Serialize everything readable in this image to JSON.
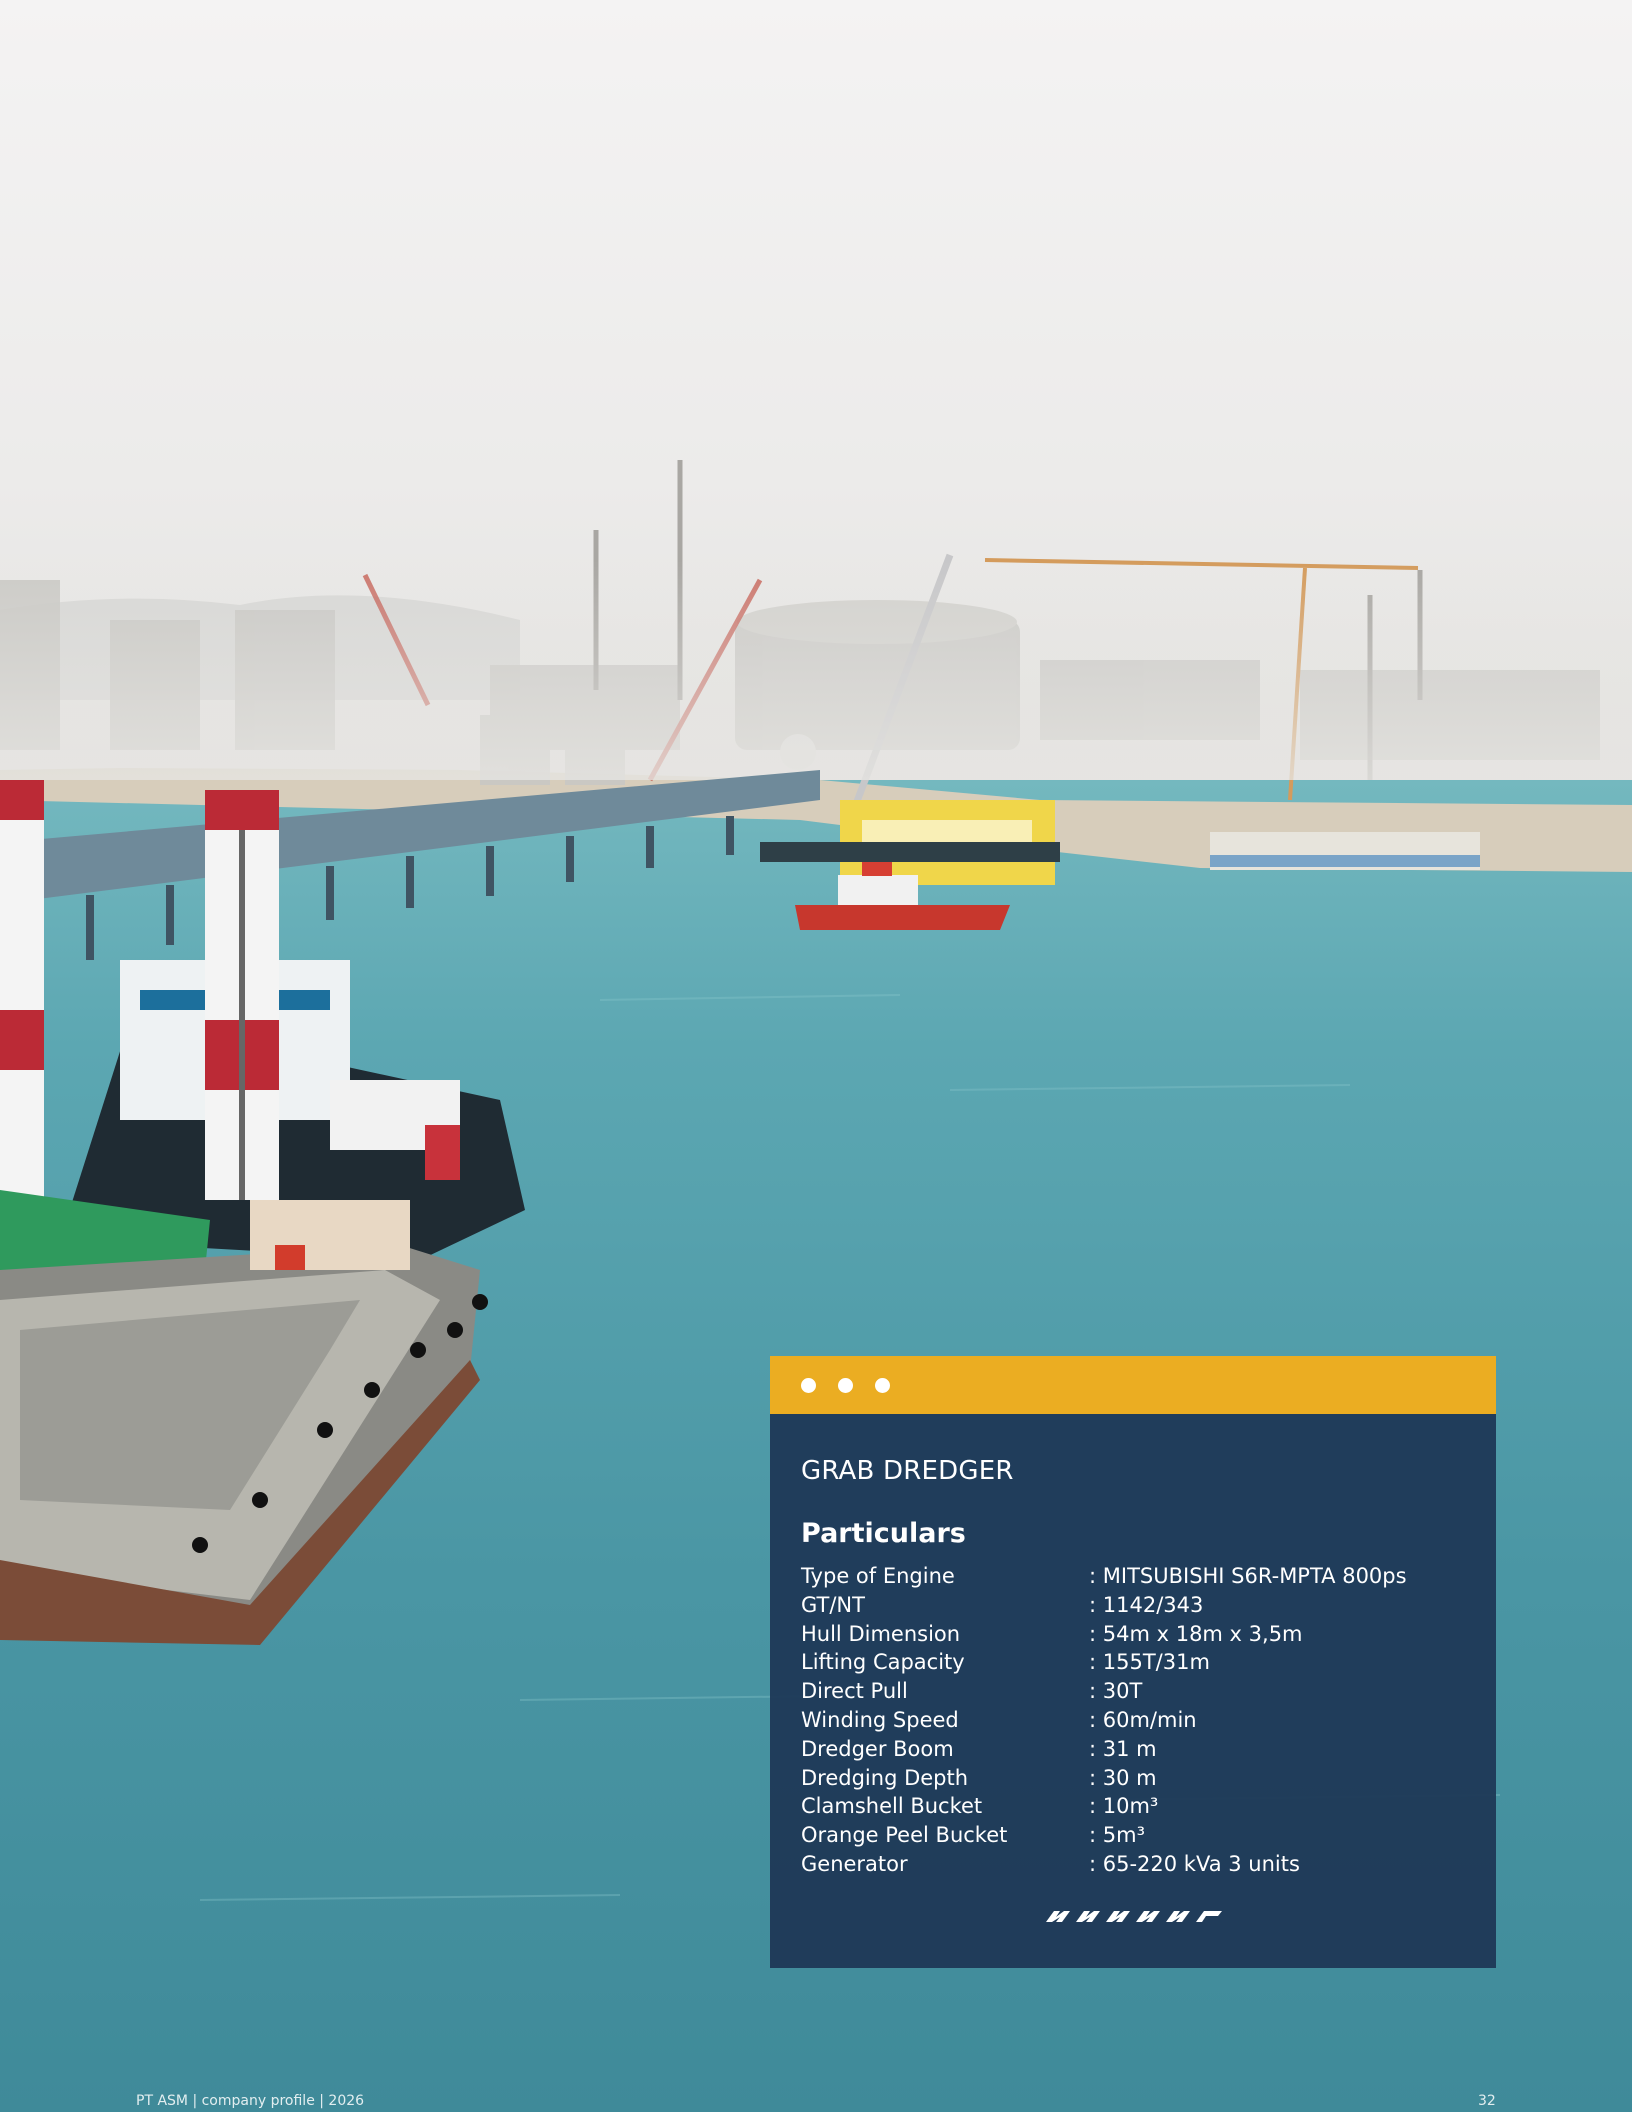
{
  "card": {
    "title": "GRAB DREDGER",
    "subtitle": "Particulars",
    "accent_color": "#ebad22",
    "background_color": "#1e3756",
    "specs": [
      {
        "label": "Type of Engine",
        "value": ": MITSUBISHI S6R-MPTA 800ps"
      },
      {
        "label": "GT/NT",
        "value": ": 1142/343"
      },
      {
        "label": "Hull Dimension",
        "value": ": 54m x 18m x 3,5m"
      },
      {
        "label": "Lifting Capacity",
        "value": ": 155T/31m"
      },
      {
        "label": "Direct Pull",
        "value": ": 30T"
      },
      {
        "label": "Winding Speed",
        "value": ": 60m/min"
      },
      {
        "label": "Dredger Boom",
        "value": ": 31 m"
      },
      {
        "label": "Dredging Depth",
        "value": ": 30 m"
      },
      {
        "label": "Clamshell Bucket",
        "value": ": 10m³"
      },
      {
        "label": "Orange Peel Bucket",
        "value": ": 5m³"
      },
      {
        "label": "Generator",
        "value": ": 65-220 kVa 3 units"
      }
    ]
  },
  "footer": {
    "left": "PT ASM | company profile | 2026",
    "page_number": "32"
  }
}
